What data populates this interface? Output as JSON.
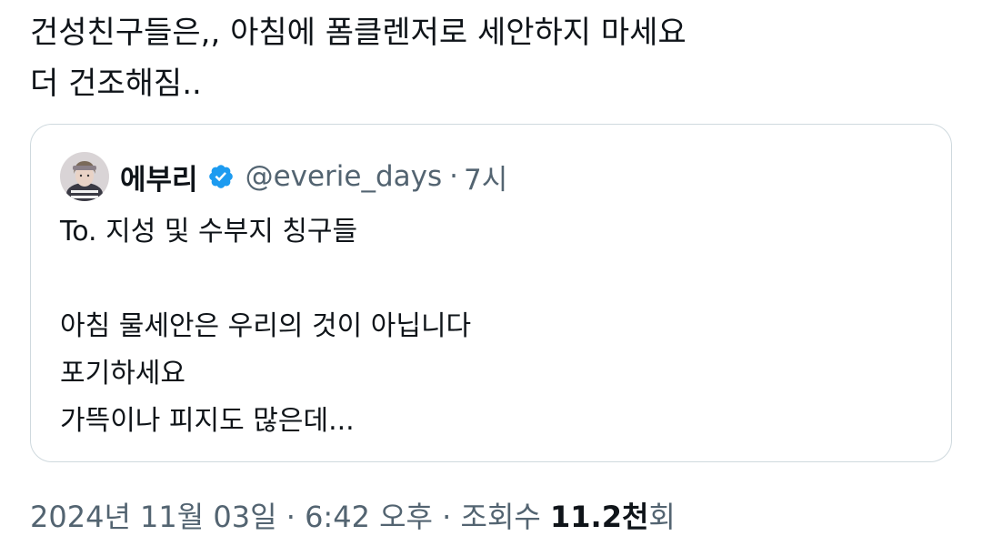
{
  "tweet": {
    "text_line_1": "건성친구들은,, 아침에 폼클렌저로 세안하지 마세요",
    "text_line_2": "더 건조해짐.."
  },
  "quoted_tweet": {
    "author_name": "에부리",
    "verified_icon": "verified-badge-icon",
    "handle": "@everie_days",
    "separator": "·",
    "time": "7시",
    "text_lines": [
      "To. 지성 및 수부지 칭구들",
      "",
      "아침 물세안은 우리의 것이 아닙니다",
      "포기하세요",
      "가뜩이나 피지도 많은데..."
    ]
  },
  "meta": {
    "date": "2024년 11월 03일",
    "sep1": " · ",
    "time": "6:42 오후",
    "sep2": " · ",
    "views_label": "조회수 ",
    "views_count": "11.2천",
    "views_suffix": "회"
  },
  "colors": {
    "text_primary": "#0f1419",
    "text_secondary": "#536471",
    "border": "#cfd9de",
    "verified_blue": "#1d9bf0"
  }
}
